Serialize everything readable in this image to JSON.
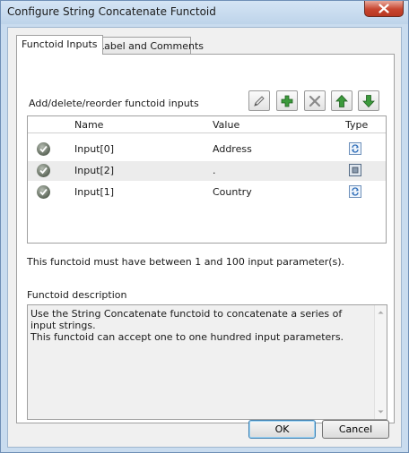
{
  "window": {
    "title": "Configure String Concatenate Functoid",
    "close_icon": "close-icon"
  },
  "tabs": [
    {
      "label": "Functoid Inputs",
      "active": true
    },
    {
      "label": "Label and Comments",
      "active": false
    }
  ],
  "toolbar": {
    "label": "Add/delete/reorder functoid inputs",
    "buttons": [
      {
        "name": "edit-input-button",
        "icon": "pencil-icon"
      },
      {
        "name": "add-input-button",
        "icon": "plus-icon"
      },
      {
        "name": "delete-input-button",
        "icon": "delete-x-icon"
      },
      {
        "name": "move-up-button",
        "icon": "arrow-up-icon"
      },
      {
        "name": "move-down-button",
        "icon": "arrow-down-icon"
      }
    ]
  },
  "grid": {
    "columns": [
      "Name",
      "Value",
      "Type"
    ],
    "rows": [
      {
        "name": "Input[0]",
        "value": "Address",
        "type": "link-type-icon"
      },
      {
        "name": "Input[2]",
        "value": ".",
        "type": "constant-type-icon"
      },
      {
        "name": "Input[1]",
        "value": "Country",
        "type": "link-type-icon"
      }
    ]
  },
  "info": "This functoid must have between 1 and 100 input parameter(s).",
  "description": {
    "label": "Functoid description",
    "text": "Use the String Concatenate functoid to concatenate a series of input strings.\nThis functoid can accept one to one hundred input parameters."
  },
  "buttons": {
    "ok": "OK",
    "cancel": "Cancel"
  },
  "colors": {
    "frame": "#c9dcef",
    "close_button": "#c7452f",
    "toolbar_green": "#3c9a3c"
  }
}
